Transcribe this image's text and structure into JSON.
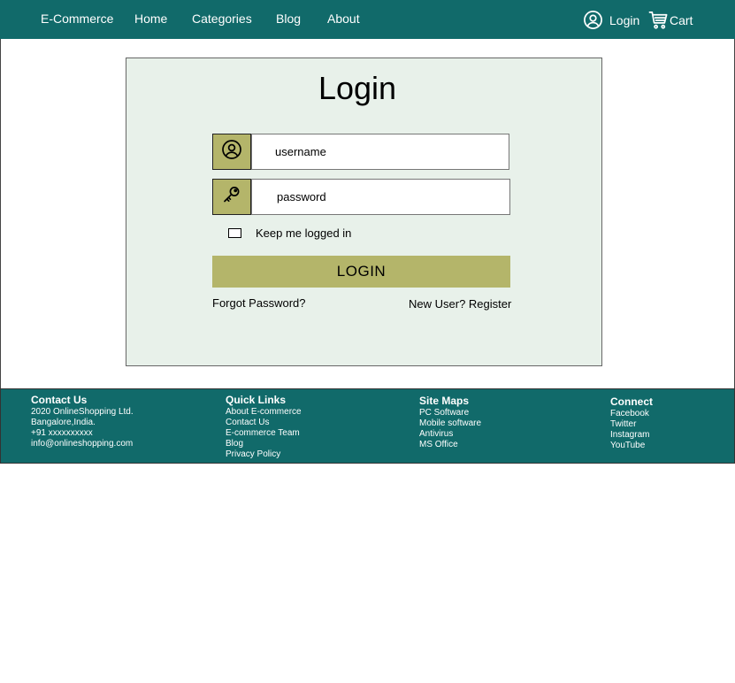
{
  "navbar": {
    "brand": "E-Commerce",
    "links": [
      "Home",
      "Categories",
      "Blog",
      "About"
    ],
    "login_label": "Login",
    "cart_label": "Cart",
    "bg_color": "#116a6a"
  },
  "login_form": {
    "title": "Login",
    "username_placeholder": "username",
    "password_placeholder": "password",
    "remember_label": "Keep me logged in",
    "remember_checked": false,
    "submit_label": "LOGIN",
    "forgot_label": "Forgot  Password?",
    "register_label": "New User? Register",
    "card_color": "#e8f1ea",
    "accent_color": "#b4b56a"
  },
  "footer": {
    "contact": {
      "heading": "Contact Us",
      "lines": [
        "2020 OnlineShopping Ltd.",
        "Bangalore,India.",
        "+91 xxxxxxxxxx",
        "info@onlineshopping.com"
      ]
    },
    "quick_links": {
      "heading": "Quick Links",
      "items": [
        "About E-commerce",
        "Contact Us",
        "E-commerce Team",
        "Blog",
        "Privacy Policy"
      ]
    },
    "site_maps": {
      "heading": "Site Maps",
      "items": [
        "PC Software",
        "Mobile software",
        "Antivirus",
        "MS Office"
      ]
    },
    "connect": {
      "heading": "Connect",
      "items": [
        "Facebook",
        "Twitter",
        "Instagram",
        "YouTube"
      ]
    }
  }
}
